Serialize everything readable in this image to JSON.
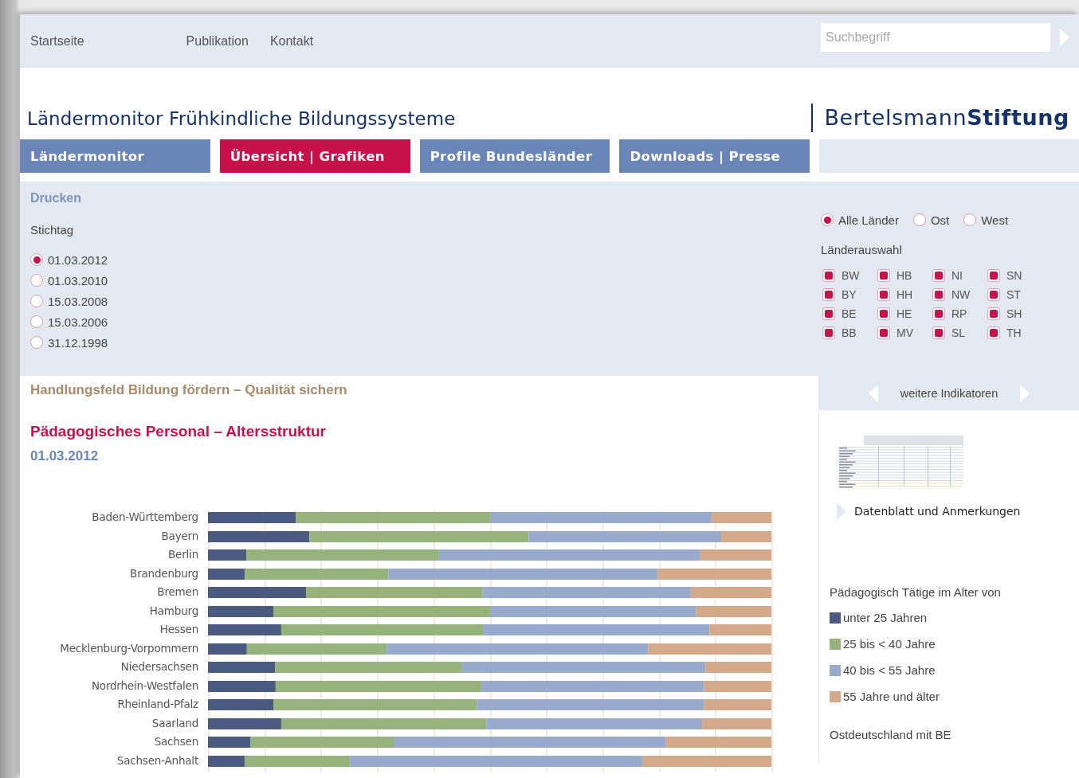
{
  "top_nav": {
    "links": [
      "Startseite",
      "Publikation",
      "Kontakt"
    ],
    "search": {
      "placeholder": "Suchbegriff"
    }
  },
  "header": {
    "title": "Ländermonitor Frühkindliche Bildungssysteme",
    "logo": "Bertelsmann**Stiftung**"
  },
  "tabs": [
    {
      "label": "Ländermonitor",
      "selected": false
    },
    {
      "label": "Übersicht | Grafiken",
      "selected": true
    },
    {
      "label": "Profile Bundesländer",
      "selected": false
    },
    {
      "label": "Downloads | Presse",
      "selected": false
    }
  ],
  "filters": {
    "print_link": "Drucken",
    "reference_date": {
      "label": "Stichtag",
      "options": [
        {
          "label": "01.03.2012",
          "selected": true
        },
        {
          "label": "01.03.2010",
          "selected": false
        },
        {
          "label": "15.03.2008",
          "selected": false
        },
        {
          "label": "15.03.2006",
          "selected": false
        },
        {
          "label": "31.12.1998",
          "selected": false
        }
      ]
    },
    "region": [
      {
        "label": "Alle Länder",
        "selected": true
      },
      {
        "label": "Ost",
        "selected": false
      },
      {
        "label": "West",
        "selected": false
      }
    ],
    "states": {
      "label": "Länderauswahl",
      "items": [
        {
          "label": "BW",
          "checked": true
        },
        {
          "label": "HB",
          "checked": true
        },
        {
          "label": "NI",
          "checked": true
        },
        {
          "label": "SN",
          "checked": true
        },
        {
          "label": "BY",
          "checked": true
        },
        {
          "label": "HH",
          "checked": true
        },
        {
          "label": "NW",
          "checked": true
        },
        {
          "label": "ST",
          "checked": true
        },
        {
          "label": "BE",
          "checked": true
        },
        {
          "label": "HE",
          "checked": true
        },
        {
          "label": "RP",
          "checked": true
        },
        {
          "label": "SH",
          "checked": true
        },
        {
          "label": "BB",
          "checked": true
        },
        {
          "label": "MV",
          "checked": true
        },
        {
          "label": "SL",
          "checked": true
        },
        {
          "label": "TH",
          "checked": true
        }
      ]
    }
  },
  "content": {
    "section": "Handlungsfeld Bildung fördern – Qualität sichern",
    "heading": "Pädagogisches Personal – Altersstruktur",
    "date": "01.03.2012",
    "chart": {
      "rows": [
        "Baden-Württemberg",
        "Bayern",
        "Berlin",
        "Brandenburg",
        "Bremen",
        "Hamburg",
        "Hessen",
        "Mecklenburg-Vorpommern",
        "Niedersachsen",
        "Nordrhein-Westfalen",
        "Rheinland-Pfalz",
        "Saarland",
        "Sachsen",
        "Sachsen-Anhalt"
      ]
    }
  },
  "sidebar": {
    "nav_label": "weitere Indikatoren",
    "datasheet_link": "Datenblatt und Anmerkungen",
    "legend": {
      "title": "Pädagogisch Tätige im Alter von",
      "items": [
        {
          "label": "unter 25 Jahren",
          "color": "#4a5a80"
        },
        {
          "label": "25 bis < 40 Jahre",
          "color": "#97b27a"
        },
        {
          "label": "40 bis < 55 Jahre",
          "color": "#98abcd"
        },
        {
          "label": "55 Jahre und älter",
          "color": "#d4a98a"
        }
      ]
    },
    "note": "Ostdeutschland mit BE"
  }
}
